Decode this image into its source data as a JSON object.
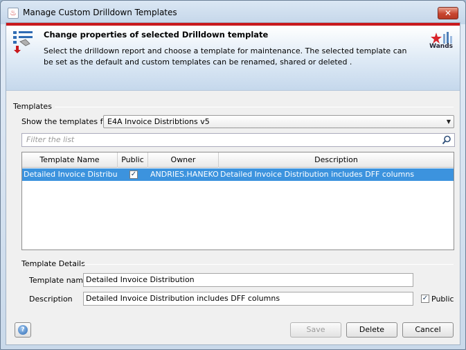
{
  "window": {
    "title": "Manage Custom Drilldown Templates",
    "close_label": "✕"
  },
  "header": {
    "title": "Change properties of selected Drilldown template",
    "description": "Select the drilldown report and choose a template for maintenance. The selected template can be set as the default and custom templates can be renamed, shared or deleted .",
    "logo_text": "Wands"
  },
  "templates_section": {
    "label": "Templates",
    "show_label": "Show the templates for",
    "selected_report": "E4A Invoice Distribtions v5",
    "filter_placeholder": "Filter the list"
  },
  "table": {
    "columns": [
      "Template Name",
      "Public",
      "Owner",
      "Description"
    ],
    "rows": [
      {
        "template_name": "Detailed Invoice Distribution",
        "public": true,
        "owner": "ANDRIES.HANEKOM",
        "description": "Detailed Invoice Distribution includes DFF columns"
      }
    ]
  },
  "details": {
    "label": "Template Details",
    "name_label": "Template name",
    "name_value": "Detailed Invoice Distribution",
    "desc_label": "Description",
    "desc_value": "Detailed Invoice Distribution includes DFF columns",
    "public_label": "Public",
    "public_checked": true
  },
  "buttons": {
    "save": "Save",
    "delete": "Delete",
    "cancel": "Cancel",
    "help": "?"
  },
  "colors": {
    "accent_red": "#c8191d",
    "selection_blue": "#3c93de"
  }
}
